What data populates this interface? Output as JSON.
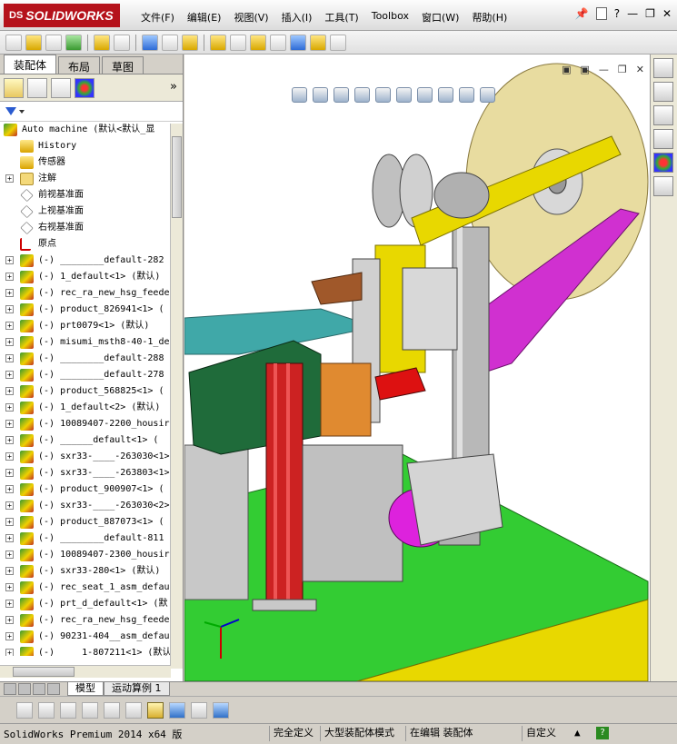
{
  "app": {
    "logo_text": "SOLIDWORKS",
    "logo_prefix": "DS"
  },
  "menu": [
    "文件(F)",
    "编辑(E)",
    "视图(V)",
    "插入(I)",
    "工具(T)",
    "Toolbox",
    "窗口(W)",
    "帮助(H)"
  ],
  "title_right": {
    "pin": "📌",
    "help": "?",
    "minimize": "—",
    "restore": "❐",
    "close": "✕"
  },
  "config_tabs": [
    "装配体",
    "布局",
    "草图"
  ],
  "panel_more": "»",
  "tree": {
    "root": "Auto machine  (默认<默认_显",
    "items": [
      {
        "label": "History",
        "icon": "history-icon",
        "type": "feature"
      },
      {
        "label": "传感器",
        "icon": "sensor-icon",
        "type": "feature"
      },
      {
        "label": "注解",
        "icon": "annotation-icon",
        "type": "ann",
        "expand": true
      },
      {
        "label": "前视基准面",
        "icon": "plane-icon",
        "type": "plane"
      },
      {
        "label": "上视基准面",
        "icon": "plane-icon",
        "type": "plane"
      },
      {
        "label": "右视基准面",
        "icon": "plane-icon",
        "type": "plane"
      },
      {
        "label": "原点",
        "icon": "origin-icon",
        "type": "origin"
      },
      {
        "label": "(-) ________default-282",
        "type": "asm",
        "expand": true
      },
      {
        "label": "(-) 1_default<1> (默认)",
        "type": "asm",
        "expand": true
      },
      {
        "label": "(-) rec_ra_new_hsg_feede",
        "type": "asm",
        "expand": true
      },
      {
        "label": "(-) product_826941<1> (",
        "type": "asm",
        "expand": true
      },
      {
        "label": "(-) prt0079<1> (默认)",
        "type": "asm",
        "expand": true
      },
      {
        "label": "(-) misumi_msth8-40-1_de",
        "type": "asm",
        "expand": true
      },
      {
        "label": "(-) ________default-288",
        "type": "asm",
        "expand": true
      },
      {
        "label": "(-) ________default-278",
        "type": "asm",
        "expand": true
      },
      {
        "label": "(-) product_568825<1> (",
        "type": "asm",
        "expand": true
      },
      {
        "label": "(-) 1_default<2> (默认)",
        "type": "asm",
        "expand": true
      },
      {
        "label": "(-) 10089407-2200_housir",
        "type": "asm",
        "expand": true
      },
      {
        "label": "(-) ______default<1> (",
        "type": "asm",
        "expand": true
      },
      {
        "label": "(-) sxr33-____-263030<1>",
        "type": "asm",
        "expand": true
      },
      {
        "label": "(-) sxr33-____-263803<1>",
        "type": "asm",
        "expand": true
      },
      {
        "label": "(-) product_900907<1> (",
        "type": "asm",
        "expand": true
      },
      {
        "label": "(-) sxr33-____-263030<2>",
        "type": "asm",
        "expand": true
      },
      {
        "label": "(-) product_887073<1> (",
        "type": "asm",
        "expand": true
      },
      {
        "label": "(-) ________default-811",
        "type": "asm",
        "expand": true
      },
      {
        "label": "(-) 10089407-2300_housir",
        "type": "asm",
        "expand": true
      },
      {
        "label": "(-) sxr33-280<1> (默认)",
        "type": "asm",
        "expand": true
      },
      {
        "label": "(-) rec_seat_1_asm_defau",
        "type": "asm",
        "expand": true
      },
      {
        "label": "(-) prt_d_default<1> (默",
        "type": "asm",
        "expand": true
      },
      {
        "label": "(-) rec_ra_new_hsg_feede",
        "type": "asm",
        "expand": true
      },
      {
        "label": "(-) 90231-404__asm_defau",
        "type": "asm",
        "expand": true
      },
      {
        "label": "(-) ____1-807211<1> (默认",
        "type": "asm",
        "expand": true
      }
    ]
  },
  "bottom_tabs": [
    "模型",
    "运动算例 1"
  ],
  "status": {
    "left": "SolidWorks Premium 2014 x64 版",
    "cells": [
      "完全定义",
      "大型装配体模式",
      "在编辑 装配体",
      "自定义"
    ],
    "caret": "▲",
    "help": "?"
  },
  "colors": {
    "table_green": "#33cc33",
    "extrusion_red": "#cc2222",
    "reel_tan": "#e8dca0",
    "motor_magenta": "#dd22dd",
    "cover_darkgreen": "#1f6b3a",
    "plate_yellow": "#e8d800"
  }
}
